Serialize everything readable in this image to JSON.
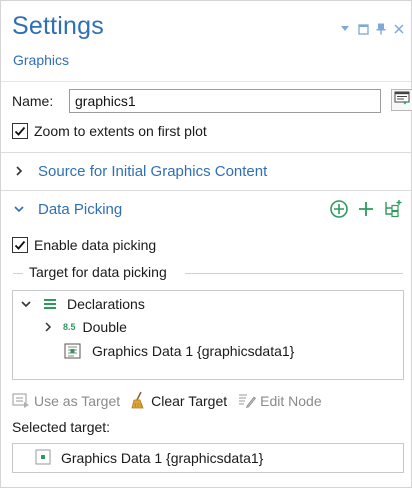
{
  "header": {
    "title": "Settings",
    "subtitle": "Graphics"
  },
  "window_controls": [
    "dropdown-arrow-icon",
    "restore-icon",
    "pin-icon",
    "close-icon"
  ],
  "name": {
    "label": "Name:",
    "value": "graphics1"
  },
  "zoom_checkbox": {
    "label": "Zoom to extents on first plot",
    "checked": true
  },
  "sections": {
    "source": {
      "label": "Source for Initial Graphics Content",
      "expanded": false
    },
    "data_picking": {
      "label": "Data Picking",
      "expanded": true
    }
  },
  "data_picking": {
    "enable_label": "Enable data picking",
    "enable_checked": true,
    "group_title": "Target for data picking",
    "tree": {
      "declarations": "Declarations",
      "double_badge": "8.5",
      "double": "Double",
      "graphics_data": "Graphics Data 1 {graphicsdata1}"
    },
    "toolbar": {
      "use_as_target": "Use as Target",
      "clear_target": "Clear Target",
      "edit_node": "Edit Node"
    },
    "selected_label": "Selected target:",
    "selected_value": "Graphics Data 1 {graphicsdata1}"
  },
  "colors": {
    "accent": "#2f6fb5",
    "green": "#2e9a5e",
    "border": "#c9c9c9"
  }
}
